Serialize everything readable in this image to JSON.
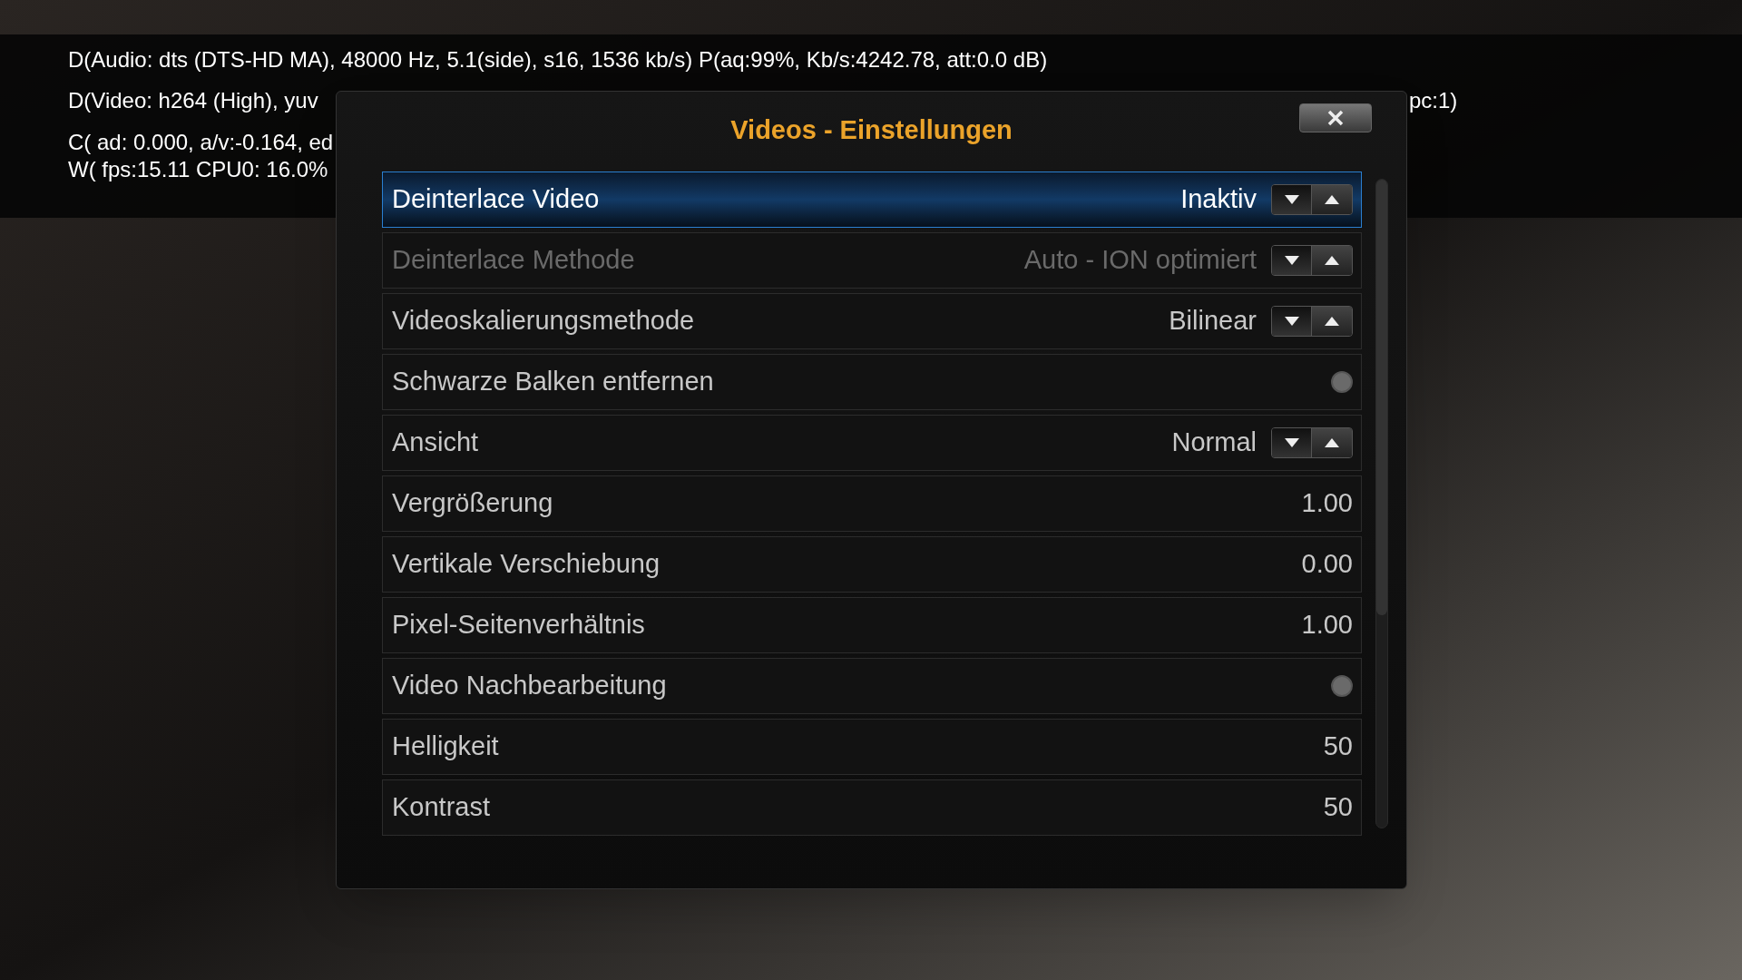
{
  "debug_overlay": {
    "lines": [
      {
        "left": "D(Audio: dts (DTS-HD MA), 48000 Hz, 5.1(side), s16, 1536 kb/s) P(aq:99%, Kb/s:4242.78, att:0.0 dB)"
      },
      {
        "left": "D(Video: h264 (High), yuv",
        "right": "pc:1)"
      },
      {
        "left": "C( ad: 0.000, a/v:-0.164, ed"
      },
      {
        "left": "W( fps:15.11 CPU0: 16.0%"
      }
    ]
  },
  "dialog": {
    "title": "Videos - Einstellungen",
    "settings": [
      {
        "kind": "spinner",
        "label": "Deinterlace Video",
        "value": "Inaktiv",
        "selected": true,
        "disabled": false
      },
      {
        "kind": "spinner",
        "label": "Deinterlace Methode",
        "value": "Auto - ION optimiert",
        "selected": false,
        "disabled": true
      },
      {
        "kind": "spinner",
        "label": "Videoskalierungsmethode",
        "value": "Bilinear",
        "selected": false,
        "disabled": false
      },
      {
        "kind": "toggle",
        "label": "Schwarze Balken entfernen",
        "on": false,
        "selected": false,
        "disabled": false
      },
      {
        "kind": "spinner",
        "label": "Ansicht",
        "value": "Normal",
        "selected": false,
        "disabled": false
      },
      {
        "kind": "value",
        "label": "Vergrößerung",
        "value": "1.00",
        "selected": false,
        "disabled": false
      },
      {
        "kind": "value",
        "label": "Vertikale Verschiebung",
        "value": "0.00",
        "selected": false,
        "disabled": false
      },
      {
        "kind": "value",
        "label": "Pixel-Seitenverhältnis",
        "value": "1.00",
        "selected": false,
        "disabled": false
      },
      {
        "kind": "toggle",
        "label": "Video Nachbearbeitung",
        "on": false,
        "selected": false,
        "disabled": false
      },
      {
        "kind": "value",
        "label": "Helligkeit",
        "value": "50",
        "selected": false,
        "disabled": false
      },
      {
        "kind": "value",
        "label": "Kontrast",
        "value": "50",
        "selected": false,
        "disabled": false
      }
    ]
  }
}
